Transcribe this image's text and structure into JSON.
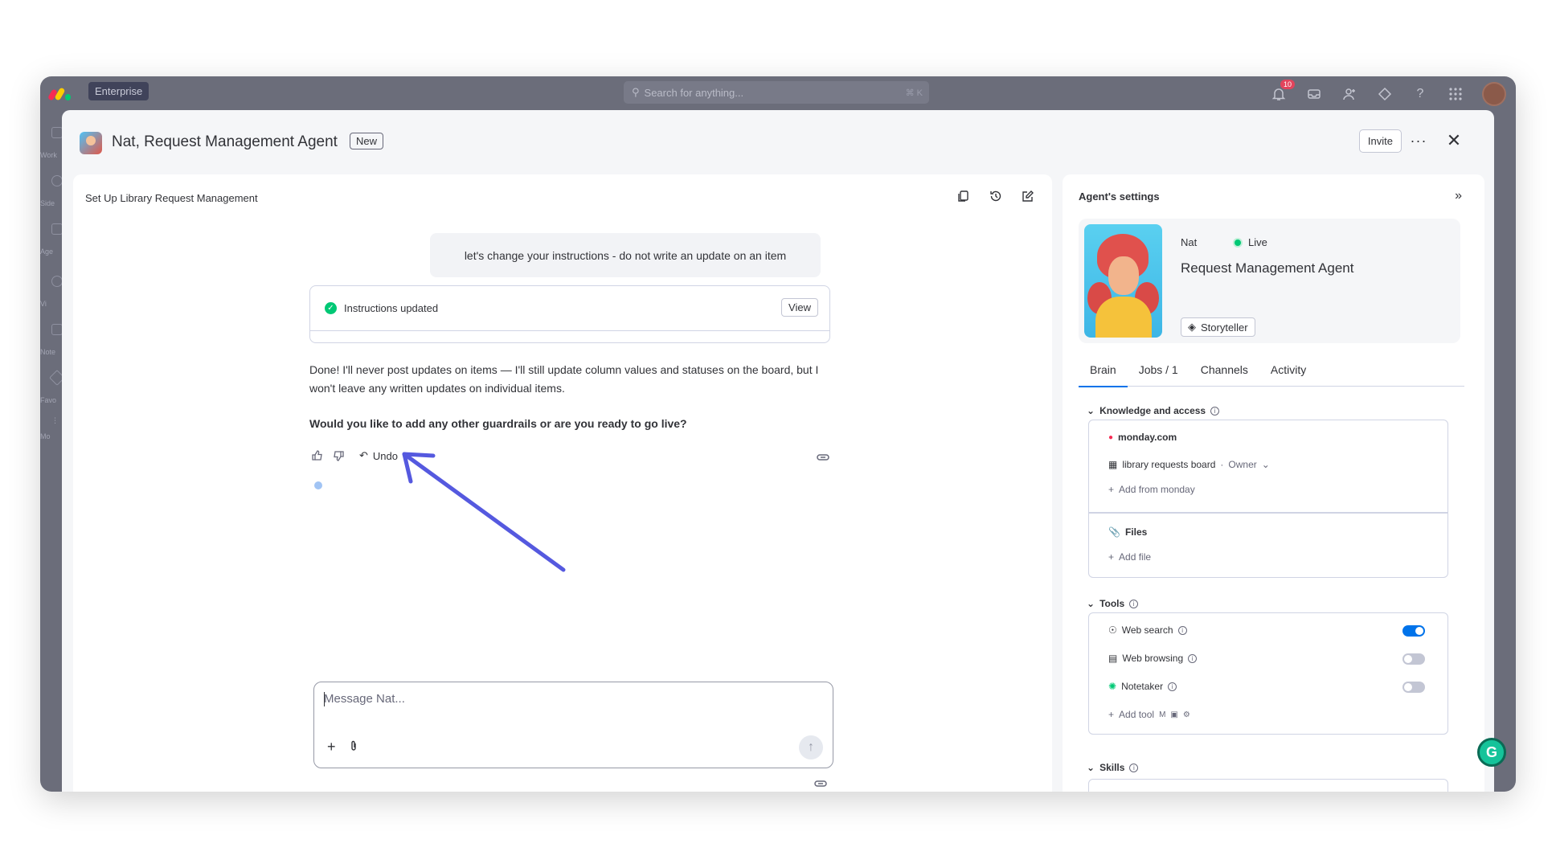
{
  "topbar": {
    "plan_badge": "Enterprise",
    "search_placeholder": "Search for anything...",
    "notifications_count": "10"
  },
  "left_rail": {
    "labels": [
      "Work",
      "Side",
      "Age",
      "Vi",
      "Note",
      "Favo",
      "Mo"
    ]
  },
  "modal": {
    "title": "Nat, Request Management Agent",
    "new_badge": "New",
    "invite_label": "Invite",
    "more_label": "···",
    "close_label": "✕"
  },
  "chat": {
    "title": "Set Up Library Request Management",
    "user_message": "let's change your instructions - do not write an update on an item",
    "instructions_card": {
      "label": "Instructions updated",
      "view_label": "View"
    },
    "reply": "Done! I'll never post updates on items — I'll still update column values and statuses on the board, but I won't leave any written updates on individual items.",
    "question": "Would you like to add any other guardrails or are you ready to go live?",
    "undo_label": "Undo",
    "composer_placeholder": "Message Nat..."
  },
  "settings": {
    "title": "Agent's settings",
    "agent": {
      "nickname": "Nat",
      "status": "Live",
      "role": "Request Management Agent",
      "persona": "Storyteller"
    },
    "tabs": [
      "Brain",
      "Jobs / 1",
      "Channels",
      "Activity"
    ],
    "active_tab": "Brain",
    "knowledge": {
      "heading": "Knowledge and access",
      "source": "monday.com",
      "board": "library requests board",
      "board_role": "Owner",
      "add_from_monday": "Add from monday",
      "files_heading": "Files",
      "add_file": "Add file"
    },
    "tools": {
      "heading": "Tools",
      "items": [
        {
          "label": "Web search",
          "enabled": true
        },
        {
          "label": "Web browsing",
          "enabled": false
        },
        {
          "label": "Notetaker",
          "enabled": false
        }
      ],
      "add_tool": "Add tool"
    },
    "skills": {
      "heading": "Skills"
    }
  },
  "colors": {
    "accent": "#0073ea",
    "live": "#00c875",
    "annotation_arrow": "#5559df",
    "frame": "#6b6d7a"
  }
}
